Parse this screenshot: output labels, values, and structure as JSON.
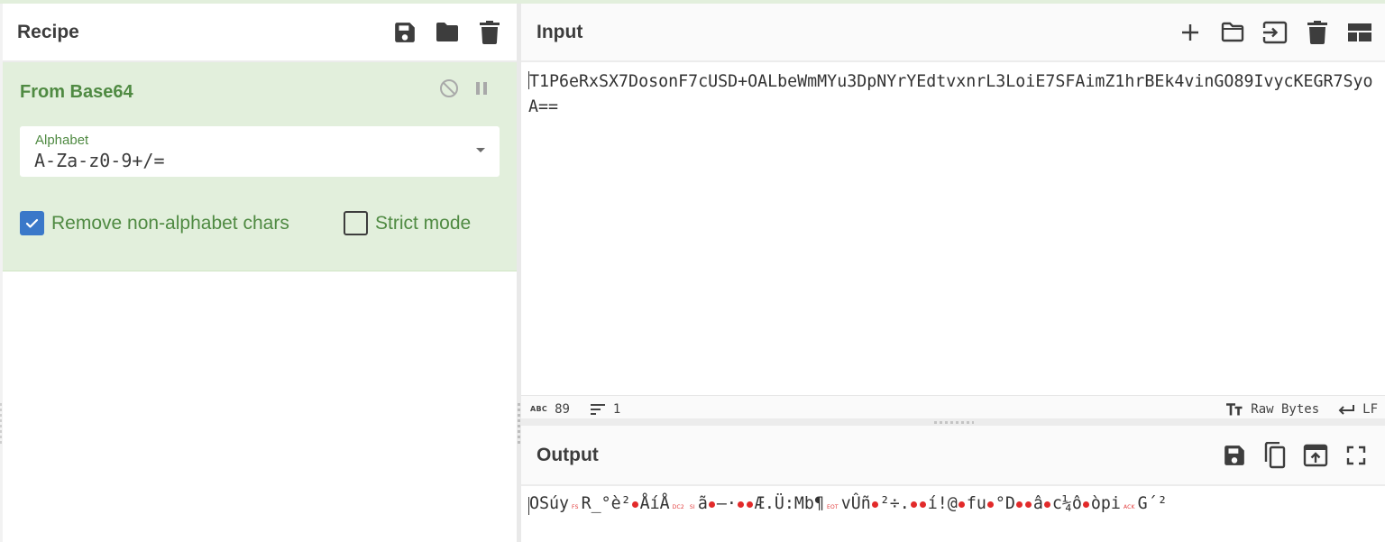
{
  "recipe": {
    "title": "Recipe",
    "header_icons": [
      "save-icon",
      "folder-icon",
      "trash-icon"
    ],
    "operation": {
      "name": "From Base64",
      "controls": [
        "disable-icon",
        "pause-icon"
      ],
      "alphabet": {
        "label": "Alphabet",
        "value": "A-Za-z0-9+/="
      },
      "options": [
        {
          "label": "Remove non-alphabet chars",
          "checked": true
        },
        {
          "label": "Strict mode",
          "checked": false
        }
      ]
    }
  },
  "input": {
    "title": "Input",
    "header_icons": [
      "plus-icon",
      "folder-open-icon",
      "import-icon",
      "trash-icon",
      "layout-icon"
    ],
    "text": "T1P6eRxSX7DosonF7cUSD+OALbeWmMYu3DpNYrYEdtvxnrL3LoiE7SFAimZ1hrBEk4vinGO89IvycKEGR7SyoA==",
    "status": {
      "char_count_icon": "ABC",
      "char_count": "89",
      "line_count": "1",
      "encoding": "Raw Bytes",
      "eol": "LF"
    }
  },
  "output": {
    "title": "Output",
    "header_icons": [
      "save-icon",
      "copy-icon",
      "replace-input-icon",
      "maximize-icon"
    ],
    "segments": [
      {
        "t": "text",
        "v": "OSúy"
      },
      {
        "t": "ctl",
        "v": "FS"
      },
      {
        "t": "text",
        "v": "R_°è²"
      },
      {
        "t": "dot"
      },
      {
        "t": "text",
        "v": "ÅíÅ"
      },
      {
        "t": "ctl",
        "v": "DC2"
      },
      {
        "t": "ctl",
        "v": "SI"
      },
      {
        "t": "text",
        "v": "ã"
      },
      {
        "t": "dot"
      },
      {
        "t": "text",
        "v": "—·"
      },
      {
        "t": "dot"
      },
      {
        "t": "dot"
      },
      {
        "t": "text",
        "v": "Æ.Ü:Mb¶"
      },
      {
        "t": "ctl",
        "v": "EOT"
      },
      {
        "t": "text",
        "v": "vÛñ"
      },
      {
        "t": "dot"
      },
      {
        "t": "text",
        "v": "²÷."
      },
      {
        "t": "dot"
      },
      {
        "t": "dot"
      },
      {
        "t": "text",
        "v": "í!@"
      },
      {
        "t": "dot"
      },
      {
        "t": "text",
        "v": "fu"
      },
      {
        "t": "dot"
      },
      {
        "t": "text",
        "v": "°D"
      },
      {
        "t": "dot"
      },
      {
        "t": "dot"
      },
      {
        "t": "text",
        "v": "â"
      },
      {
        "t": "dot"
      },
      {
        "t": "text",
        "v": "c¼ô"
      },
      {
        "t": "dot"
      },
      {
        "t": "text",
        "v": "òpi"
      },
      {
        "t": "ctl",
        "v": "ACK"
      },
      {
        "t": "text",
        "v": "G´²"
      }
    ]
  },
  "colors": {
    "operation_bg": "#e2efdc",
    "operation_text": "#4f8a42",
    "checkbox_on": "#3a78c9",
    "control_char": "#e23b3b"
  }
}
